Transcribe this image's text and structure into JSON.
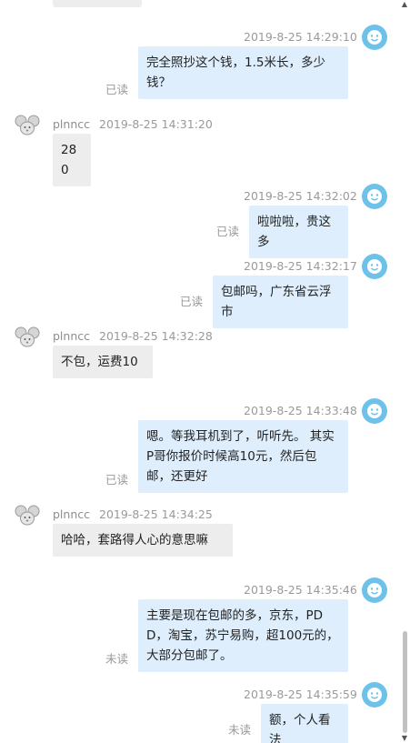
{
  "messages": [
    {
      "sender": "me",
      "time": "2019-8-25 14:29:10",
      "text": "完全照抄这个钱，1.5米长，多少钱？",
      "status": "已读"
    },
    {
      "sender": "peer",
      "name": "plnncc",
      "time": "2019-8-25 14:31:20",
      "text": "280"
    },
    {
      "sender": "me",
      "time": "2019-8-25 14:32:02",
      "text": "啦啦啦，贵这多",
      "status": "已读"
    },
    {
      "sender": "me",
      "time": "2019-8-25 14:32:17",
      "text": "包邮吗，广东省云浮市",
      "status": "已读"
    },
    {
      "sender": "peer",
      "name": "plnncc",
      "time": "2019-8-25 14:32:28",
      "text": "不包，运费10"
    },
    {
      "sender": "me",
      "time": "2019-8-25 14:33:48",
      "text": "嗯。等我耳机到了，听听先。 其实P哥你报价时候高10元，然后包邮，还更好",
      "status": "已读"
    },
    {
      "sender": "peer",
      "name": "plnncc",
      "time": "2019-8-25 14:34:25",
      "text": "哈哈，套路得人心的意思嘛"
    },
    {
      "sender": "me",
      "time": "2019-8-25 14:35:46",
      "text": "主要是现在包邮的多，京东，PDD，淘宝，苏宁易购，超100元的，大部分包邮了。",
      "status": "未读"
    },
    {
      "sender": "me",
      "time": "2019-8-25 14:35:59",
      "text": "额，个人看法",
      "status": "未读"
    }
  ],
  "scrollbar": {
    "up_arrow": "▲",
    "down_arrow": "▼"
  },
  "colors": {
    "my_bubble": "#deeefc",
    "peer_bubble": "#ededed",
    "my_avatar": "#6ec2ea"
  }
}
